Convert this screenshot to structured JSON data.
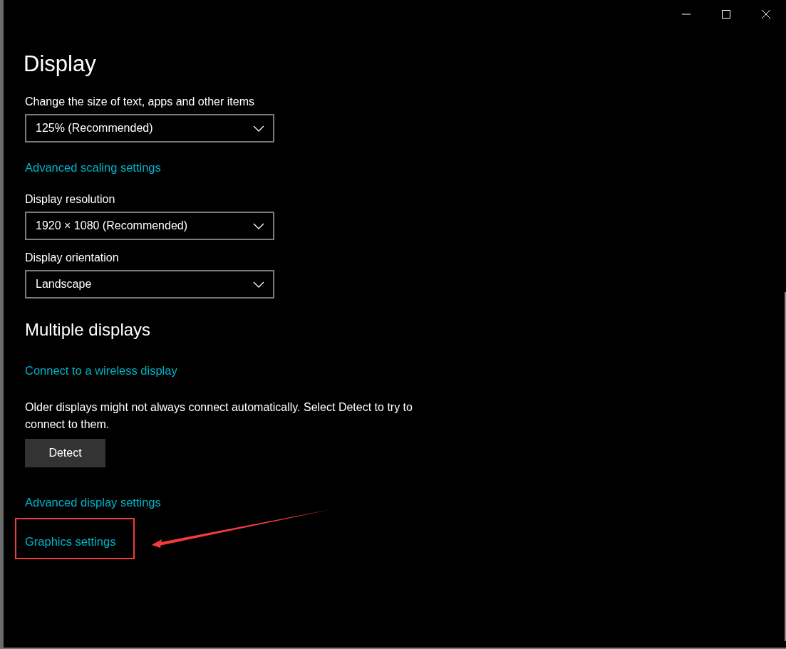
{
  "window": {
    "title": "Display"
  },
  "scale": {
    "items": [
      {
        "kind": "dropdown",
        "label": "Change the size of text, apps and other items",
        "value": "125% (Recommended)"
      },
      {
        "kind": "link",
        "text": "Advanced scaling settings",
        "highlighted": false
      },
      {
        "kind": "dropdown",
        "label": "Display resolution",
        "value": "1920 × 1080 (Recommended)"
      },
      {
        "kind": "dropdown",
        "label": "Display orientation",
        "value": "Landscape"
      }
    ]
  },
  "multiple_displays": {
    "heading": "Multiple displays",
    "items": [
      {
        "kind": "link",
        "text": "Connect to a wireless display",
        "highlighted": false
      },
      {
        "kind": "text",
        "text": "Older displays might not always connect automatically. Select Detect to try to connect to them."
      },
      {
        "kind": "button",
        "text": "Detect"
      },
      {
        "kind": "link",
        "text": "Advanced display settings",
        "highlighted": false
      },
      {
        "kind": "link",
        "text": "Graphics settings",
        "highlighted": true
      }
    ]
  }
}
